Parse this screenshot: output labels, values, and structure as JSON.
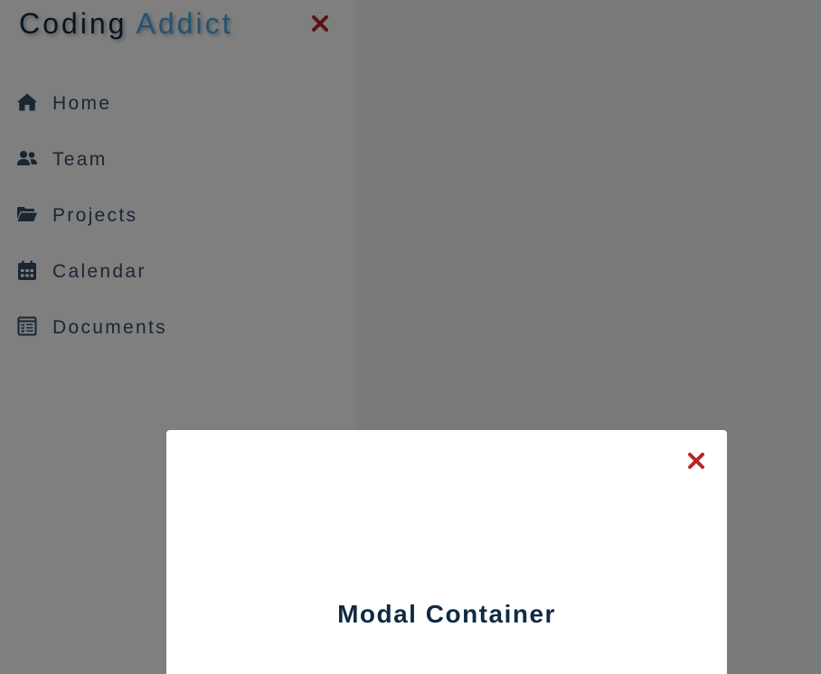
{
  "sidebar": {
    "logo": {
      "part_one": "Coding",
      "part_two": "Addict"
    },
    "close_icon": "close-icon",
    "items": [
      {
        "label": "Home",
        "icon": "home-icon"
      },
      {
        "label": "Team",
        "icon": "users-icon"
      },
      {
        "label": "Projects",
        "icon": "folder-open-icon"
      },
      {
        "label": "Calendar",
        "icon": "calendar-icon"
      },
      {
        "label": "Documents",
        "icon": "document-icon"
      }
    ]
  },
  "modal": {
    "title": "Modal Container",
    "close_icon": "close-icon"
  },
  "colors": {
    "primary_dark": "#102a42",
    "logo_accent": "#49a6e9",
    "link_text": "#324d67",
    "close_red": "#bb2525",
    "overlay": "rgba(0,0,0,0.5)"
  }
}
